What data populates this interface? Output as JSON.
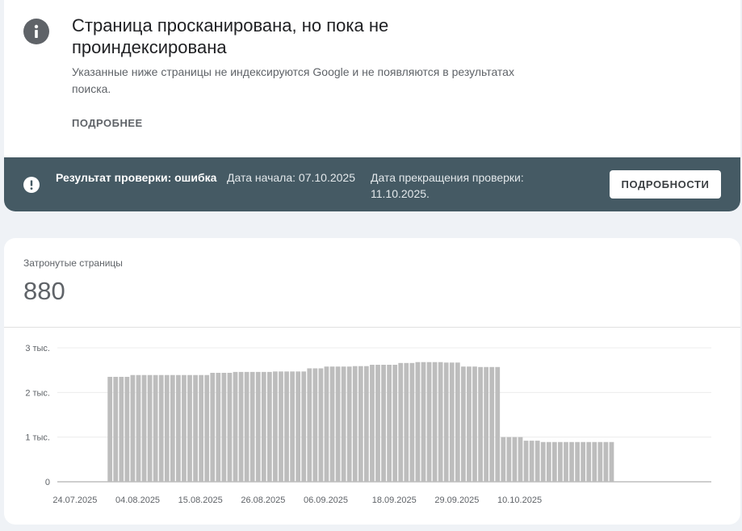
{
  "issue": {
    "title": "Страница просканирована, но пока не проиндексирована",
    "description": "Указанные ниже страницы не индексируются Google и не появляются в результатах поиска.",
    "learn_more": "ПОДРОБНЕЕ",
    "icon": "info-icon"
  },
  "validation": {
    "result": "Результат проверки: ошибка",
    "start": "Дата начала: 07.10.2025",
    "end": "Дата прекращения проверки: 11.10.2025.",
    "details_button": "ПОДРОБНОСТИ",
    "icon": "alert-icon",
    "bar_color": "#455a64"
  },
  "metric": {
    "label": "Затронутые страницы",
    "value": "880"
  },
  "chart_data": {
    "type": "bar",
    "bar_color": "#bdbdbd",
    "ylim": [
      0,
      3000
    ],
    "yticks": [
      {
        "value": 0,
        "label": "0"
      },
      {
        "value": 1000,
        "label": "1 тыс."
      },
      {
        "value": 2000,
        "label": "2 тыс."
      },
      {
        "value": 3000,
        "label": "3 тыс."
      }
    ],
    "x_tick_labels": [
      {
        "index": 0,
        "label": "24.07.2025"
      },
      {
        "index": 11,
        "label": "04.08.2025"
      },
      {
        "index": 22,
        "label": "15.08.2025"
      },
      {
        "index": 33,
        "label": "26.08.2025"
      },
      {
        "index": 44,
        "label": "06.09.2025"
      },
      {
        "index": 56,
        "label": "18.09.2025"
      },
      {
        "index": 67,
        "label": "29.09.2025"
      },
      {
        "index": 78,
        "label": "10.10.2025"
      }
    ],
    "values": [
      null,
      null,
      null,
      null,
      null,
      2350,
      2350,
      2350,
      2350,
      2390,
      2390,
      2390,
      2390,
      2390,
      2390,
      2390,
      2390,
      2390,
      2390,
      2390,
      2390,
      2390,
      2390,
      2440,
      2440,
      2440,
      2440,
      2460,
      2460,
      2460,
      2460,
      2460,
      2460,
      2460,
      2470,
      2470,
      2470,
      2470,
      2470,
      2470,
      2540,
      2540,
      2540,
      2580,
      2580,
      2580,
      2580,
      2580,
      2590,
      2590,
      2590,
      2620,
      2620,
      2620,
      2620,
      2620,
      2660,
      2660,
      2660,
      2680,
      2680,
      2680,
      2680,
      2680,
      2670,
      2670,
      2670,
      2580,
      2580,
      2580,
      2570,
      2570,
      2570,
      2570,
      1000,
      1000,
      1000,
      1000,
      920,
      920,
      920,
      890,
      890,
      890,
      890,
      890,
      890,
      890,
      890,
      890,
      890,
      890,
      890,
      890
    ]
  }
}
